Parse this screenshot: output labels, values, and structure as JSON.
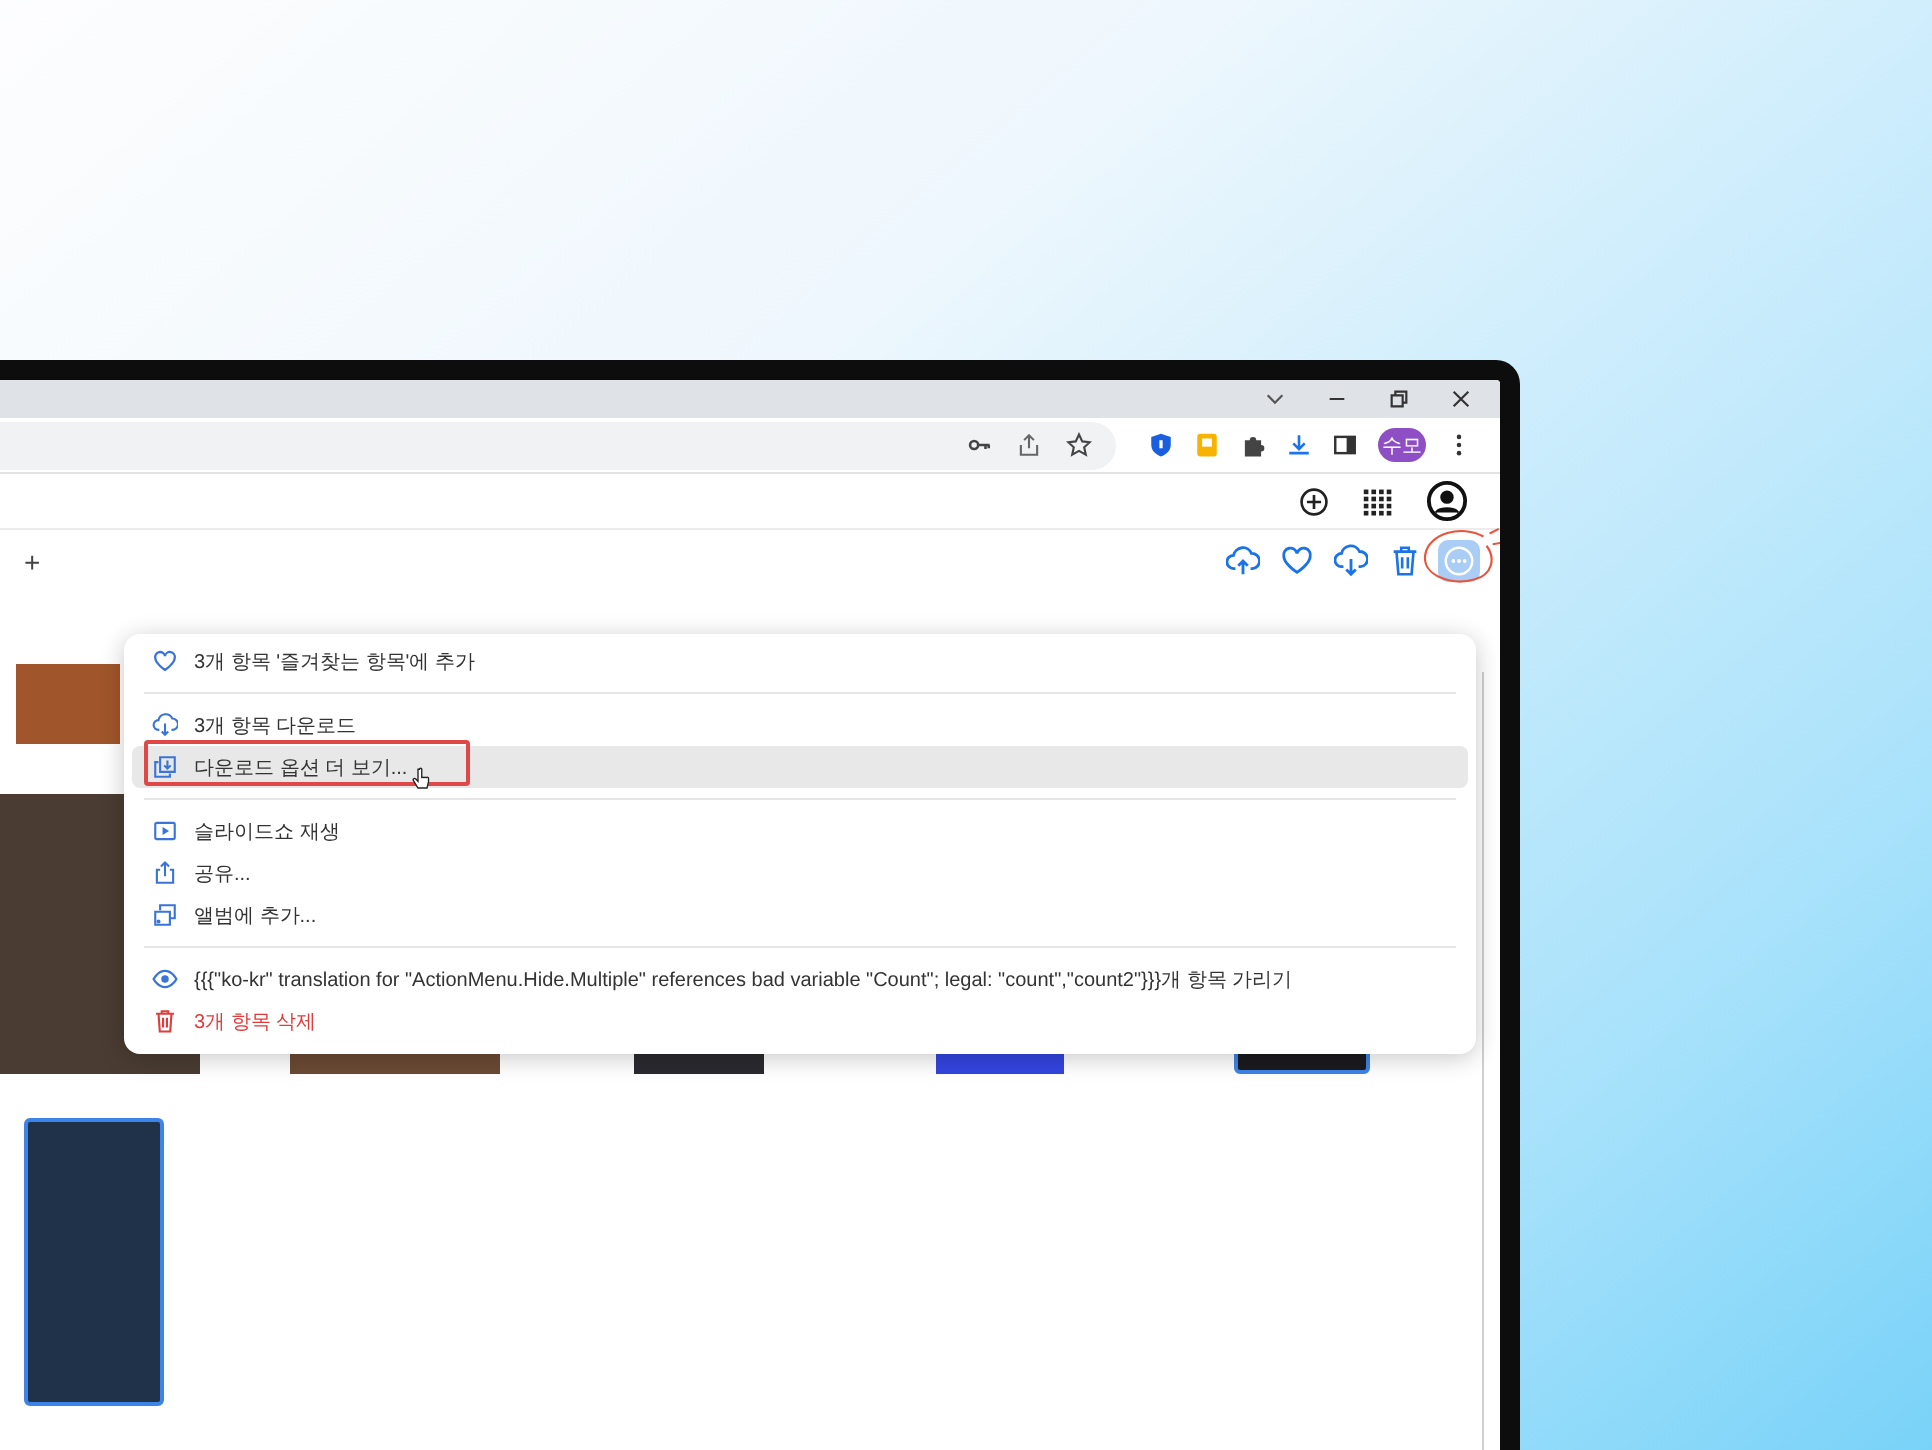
{
  "browser": {
    "avatar_initials": "수모"
  },
  "toolbar": {
    "left_button": "+",
    "actions": [
      {
        "kind": "upload",
        "selected": false
      },
      {
        "kind": "heart",
        "selected": false
      },
      {
        "kind": "download",
        "selected": false
      },
      {
        "kind": "trash",
        "selected": false
      },
      {
        "kind": "more",
        "selected": true,
        "annotated": true
      }
    ]
  },
  "thumbnails": [
    {
      "kind": "photo",
      "selected": false
    },
    {
      "kind": "photo",
      "selected": false
    },
    {
      "kind": "photo",
      "selected": false
    },
    {
      "kind": "screenshot",
      "selected": false
    },
    {
      "kind": "screenshot",
      "selected": false
    },
    {
      "kind": "screenshot",
      "selected": true
    },
    {
      "kind": "screenshot",
      "selected": true
    }
  ],
  "menu": [
    {
      "kind": "favorite",
      "label": "3개 항목 '즐겨찾는 항목'에 추가",
      "selected": false,
      "danger": false,
      "annotated": false
    },
    {
      "kind": "divider"
    },
    {
      "kind": "download",
      "label": "3개 항목 다운로드",
      "selected": false,
      "danger": false,
      "annotated": false
    },
    {
      "kind": "download-options",
      "label": "다운로드 옵션 더 보기...",
      "selected": true,
      "danger": false,
      "annotated": true
    },
    {
      "kind": "divider"
    },
    {
      "kind": "slideshow",
      "label": "슬라이드쇼 재생",
      "selected": false,
      "danger": false,
      "annotated": false
    },
    {
      "kind": "share",
      "label": "공유...",
      "selected": false,
      "danger": false,
      "annotated": false
    },
    {
      "kind": "album",
      "label": "앨범에 추가...",
      "selected": false,
      "danger": false,
      "annotated": false
    },
    {
      "kind": "divider"
    },
    {
      "kind": "hide",
      "label": "{{{\"ko-kr\" translation for \"ActionMenu.Hide.Multiple\" references bad variable \"Count\"; legal: \"count\",\"count2\"}}}개 항목 가리기",
      "selected": false,
      "danger": false,
      "annotated": false
    },
    {
      "kind": "delete",
      "label": "3개 항목 삭제",
      "selected": false,
      "danger": true,
      "annotated": false
    }
  ]
}
